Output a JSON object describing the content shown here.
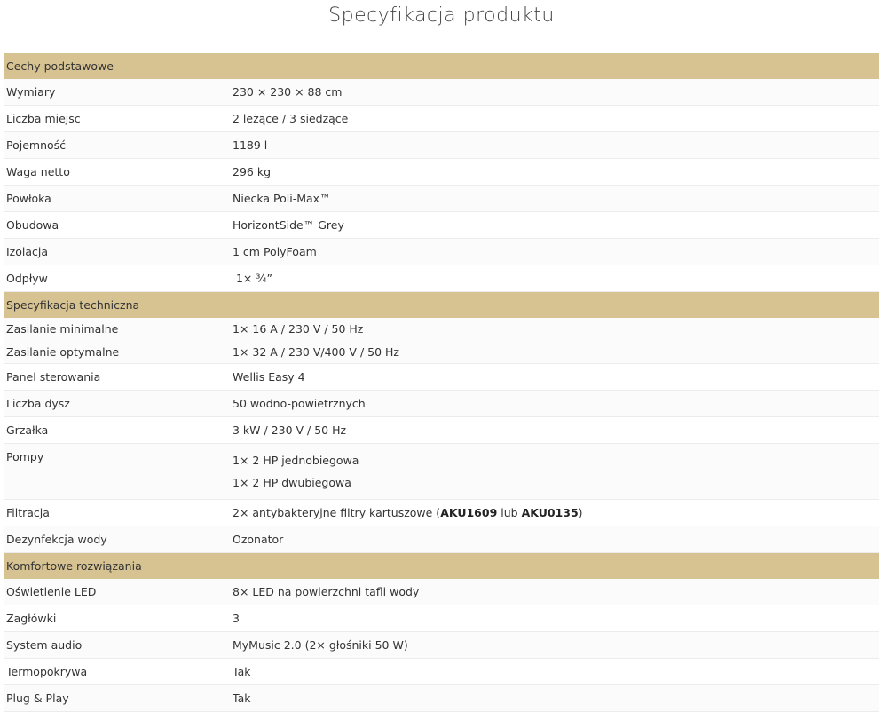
{
  "page": {
    "title": "Specyfikacja produktu"
  },
  "sections": [
    {
      "title": "Cechy podstawowe",
      "rows": [
        {
          "label": "Wymiary",
          "values": [
            "230 × 230 × 88 cm"
          ]
        },
        {
          "label": "Liczba miejsc",
          "values": [
            "2 leżące / 3 siedzące"
          ]
        },
        {
          "label": "Pojemność",
          "values": [
            "1189 l"
          ]
        },
        {
          "label": "Waga netto",
          "values": [
            "296 kg"
          ]
        },
        {
          "label": "Powłoka",
          "values": [
            "Niecka Poli-Max™"
          ]
        },
        {
          "label": "Obudowa",
          "values": [
            "HorizontSide™ Grey"
          ]
        },
        {
          "label": "Izolacja",
          "values": [
            "1 cm PolyFoam"
          ]
        },
        {
          "label": "Odpływ",
          "values": [
            " 1× ¾”"
          ]
        }
      ]
    },
    {
      "title": "Specyfikacja techniczna",
      "rows": [
        {
          "label": "Zasilanie minimalne",
          "values": [
            "1× 16 A / 230 V / 50 Hz"
          ]
        },
        {
          "label": "Zasilanie optymalne",
          "values": [
            "1× 32 A / 230 V/400 V / 50 Hz"
          ]
        },
        {
          "label": "Panel sterowania",
          "values": [
            "Wellis Easy 4"
          ]
        },
        {
          "label": "Liczba dysz",
          "values": [
            "50 wodno-powietrznych"
          ]
        },
        {
          "label": "Grzałka",
          "values": [
            "3 kW / 230 V / 50 Hz"
          ]
        },
        {
          "label": "Pompy",
          "values": [
            "1× 2 HP jednobiegowa",
            "1× 2 HP dwubiegowa"
          ]
        },
        {
          "label": "Filtracja",
          "filtration": {
            "prefix": "2× antybakteryjne filtry kartuszowe (",
            "link1": "AKU1609",
            "middle": " lub ",
            "link2": "AKU0135",
            "suffix": ")"
          }
        },
        {
          "label": "Dezynfekcja wody",
          "values": [
            "Ozonator"
          ]
        }
      ]
    },
    {
      "title": "Komfortowe rozwiązania",
      "rows": [
        {
          "label": "Oświetlenie LED",
          "values": [
            "8× LED na powierzchni tafli wody"
          ]
        },
        {
          "label": "Zagłówki",
          "values": [
            "3"
          ]
        },
        {
          "label": "System audio",
          "values": [
            "MyMusic 2.0 (2× głośniki 50 W)"
          ]
        },
        {
          "label": "Termopokrywa",
          "values": [
            "Tak"
          ]
        },
        {
          "label": "Plug & Play",
          "values": [
            "Tak"
          ]
        }
      ]
    }
  ],
  "colors": {
    "section_header_bg": "#d7c392",
    "text": "#333333",
    "row_divider": "#ececec"
  }
}
